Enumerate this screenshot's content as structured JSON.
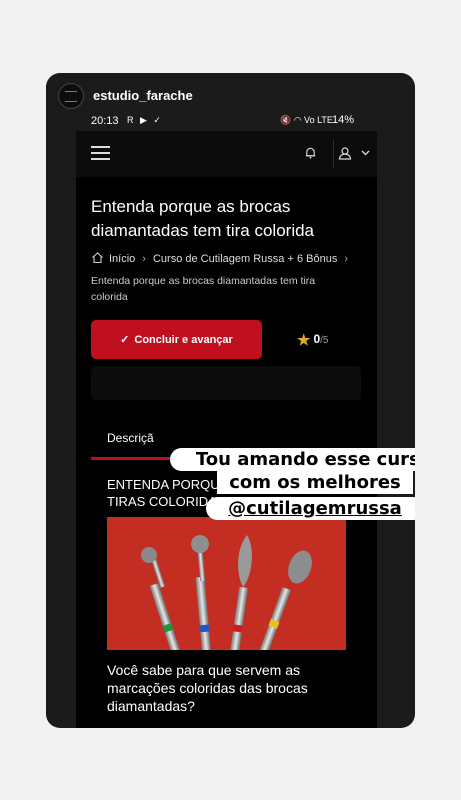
{
  "instagram": {
    "username": "estudio_farache"
  },
  "status_bar": {
    "time": "20:13",
    "left_icons": "R ▶ ✓",
    "right_icons": "🔇 ◠ Vo LTE",
    "battery": "14%"
  },
  "app": {
    "lesson_title": "Entenda porque as brocas diamantadas tem tira colorida",
    "breadcrumb": {
      "home": "Início",
      "course": "Curso de Cutilagem Russa + 6 Bônus"
    },
    "lesson_subtitle": "Entenda porque as brocas diamantadas tem tira colorida",
    "complete_button": "Concluir e avançar",
    "rating": {
      "value": "0",
      "max": "/5"
    },
    "tab_description": "Descriçã",
    "section_heading": "ENTENDA PORQUE AS BROCAS TEM TIRAS COLORIDAS",
    "question": "Você sabe para que servem as marcações coloridas das brocas diamantadas?"
  },
  "sticker": {
    "line1": "Tou amando esse curso",
    "line2": "com os melhores",
    "line3": "@cutilagemrussa"
  },
  "colors": {
    "accent": "#c0101f",
    "hero_bg": "#c42e22",
    "star": "#e0a92a"
  },
  "drill_bands": [
    "#1a9a3a",
    "#1f55c8",
    "#d11a1a",
    "#e8c21a"
  ]
}
